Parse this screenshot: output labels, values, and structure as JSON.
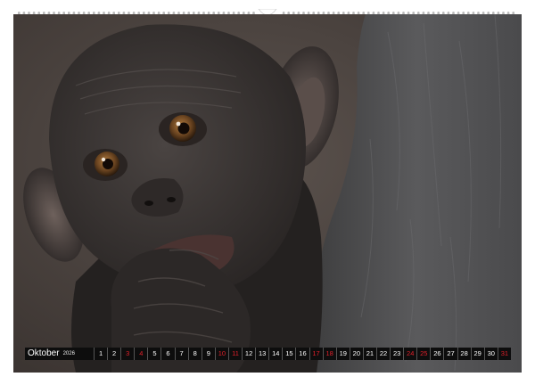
{
  "calendar": {
    "month": "Oktober",
    "year": "2026",
    "days": [
      {
        "n": "1",
        "weekend": false
      },
      {
        "n": "2",
        "weekend": false
      },
      {
        "n": "3",
        "weekend": true
      },
      {
        "n": "4",
        "weekend": true
      },
      {
        "n": "5",
        "weekend": false
      },
      {
        "n": "6",
        "weekend": false
      },
      {
        "n": "7",
        "weekend": false
      },
      {
        "n": "8",
        "weekend": false
      },
      {
        "n": "9",
        "weekend": false
      },
      {
        "n": "10",
        "weekend": true
      },
      {
        "n": "11",
        "weekend": true
      },
      {
        "n": "12",
        "weekend": false
      },
      {
        "n": "13",
        "weekend": false
      },
      {
        "n": "14",
        "weekend": false
      },
      {
        "n": "15",
        "weekend": false
      },
      {
        "n": "16",
        "weekend": false
      },
      {
        "n": "17",
        "weekend": true
      },
      {
        "n": "18",
        "weekend": true
      },
      {
        "n": "19",
        "weekend": false
      },
      {
        "n": "20",
        "weekend": false
      },
      {
        "n": "21",
        "weekend": false
      },
      {
        "n": "22",
        "weekend": false
      },
      {
        "n": "23",
        "weekend": false
      },
      {
        "n": "24",
        "weekend": true
      },
      {
        "n": "25",
        "weekend": true
      },
      {
        "n": "26",
        "weekend": false
      },
      {
        "n": "27",
        "weekend": false
      },
      {
        "n": "28",
        "weekend": false
      },
      {
        "n": "29",
        "weekend": false
      },
      {
        "n": "30",
        "weekend": false
      },
      {
        "n": "31",
        "weekend": true
      }
    ]
  },
  "colors": {
    "strip_background": "#0d0d0d",
    "weekday_text": "#ffffff",
    "weekend_text": "#e0202a",
    "photo_background": "#4d4541"
  }
}
